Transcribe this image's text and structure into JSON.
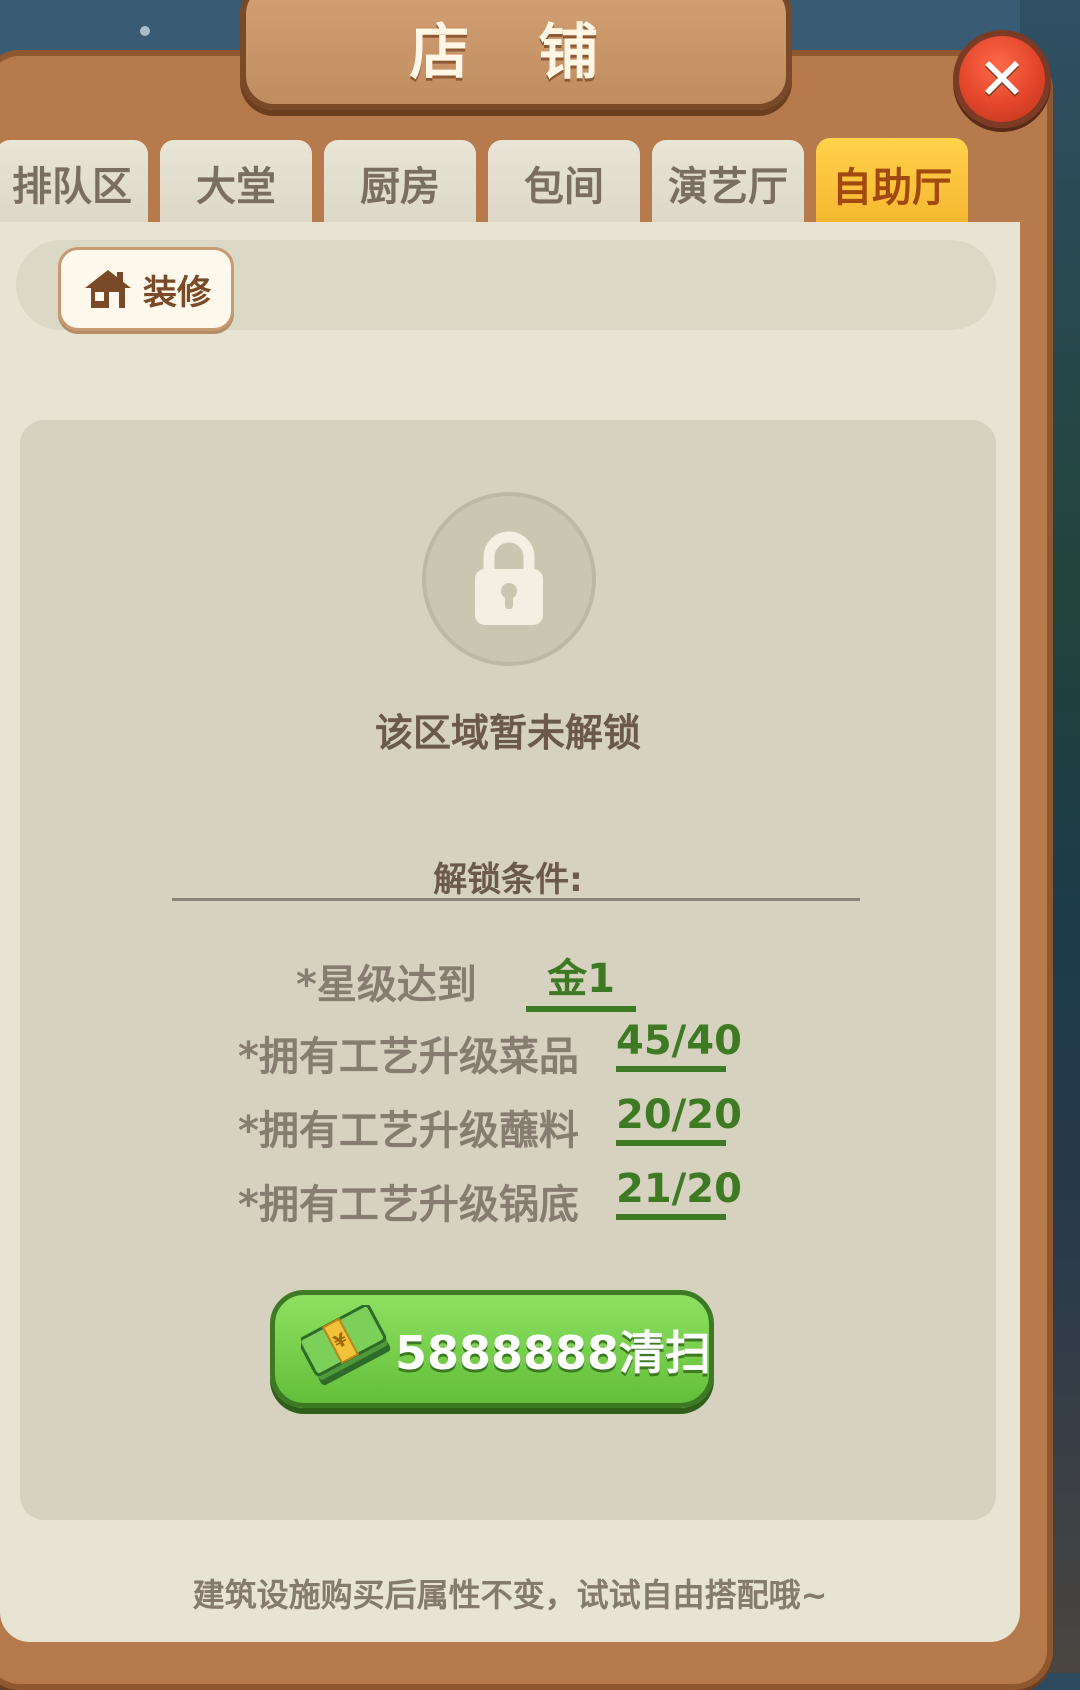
{
  "window": {
    "title": "店 铺"
  },
  "tabs": [
    {
      "label": "排队区",
      "active": false
    },
    {
      "label": "大堂",
      "active": false
    },
    {
      "label": "厨房",
      "active": false
    },
    {
      "label": "包间",
      "active": false
    },
    {
      "label": "演艺厅",
      "active": false
    },
    {
      "label": "自助厅",
      "active": true
    }
  ],
  "decorate": {
    "label": "装修",
    "icon": "house-icon"
  },
  "locked": {
    "icon": "lock-icon",
    "message": "该区域暂未解锁"
  },
  "conditions": {
    "title": "解锁条件:",
    "items": [
      {
        "label": "*星级达到",
        "value": "金1"
      },
      {
        "label": "*拥有工艺升级菜品",
        "value": "45/40"
      },
      {
        "label": "*拥有工艺升级蘸料",
        "value": "20/20"
      },
      {
        "label": "*拥有工艺升级锅底",
        "value": "21/20"
      }
    ]
  },
  "clean_button": {
    "label": "5888888清扫",
    "icon": "cash-icon"
  },
  "footer": {
    "tip": "建筑设施购买后属性不变，试试自由搭配哦~"
  },
  "colors": {
    "accent_green": "#3d7a23",
    "active_tab": "#f5b52e",
    "wood": "#b77a4c"
  }
}
